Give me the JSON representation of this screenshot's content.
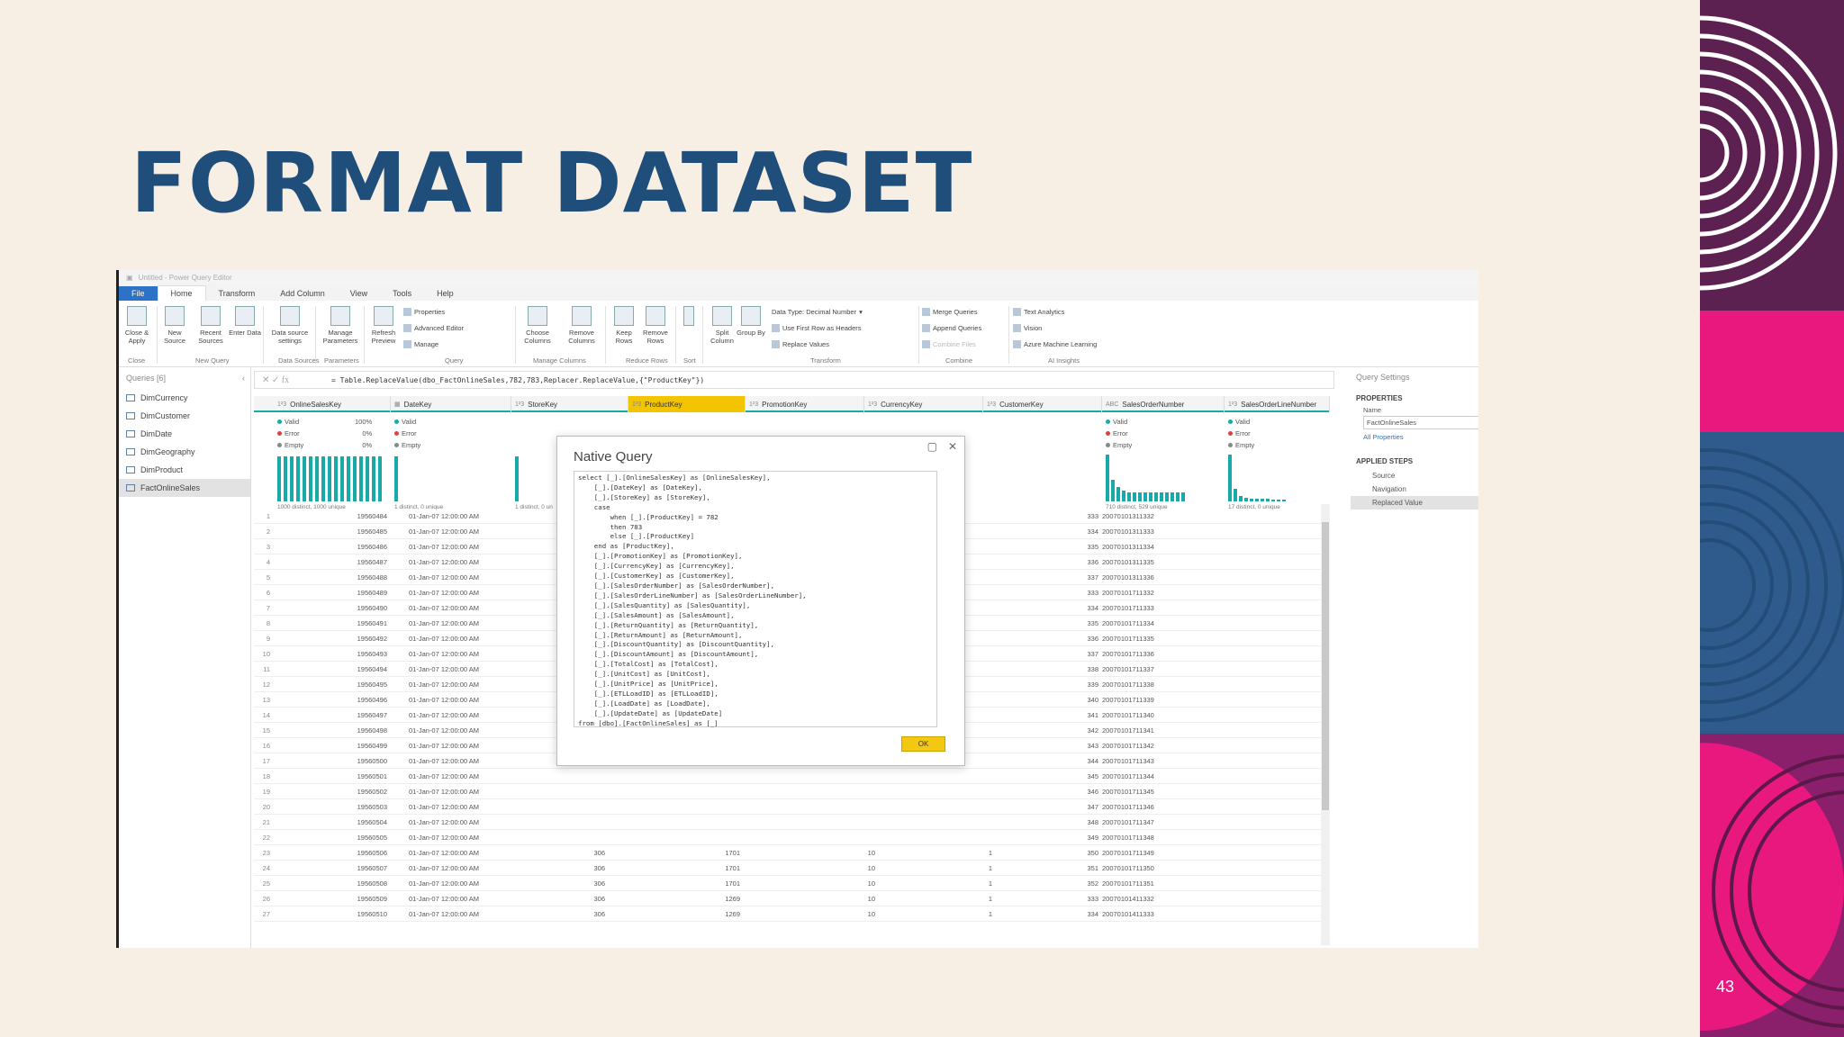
{
  "slide": {
    "title": "FORMAT DATASET",
    "number": "43"
  },
  "app": {
    "title": "Untitled - Power Query Editor",
    "menu": [
      "File",
      "Home",
      "Transform",
      "Add Column",
      "View",
      "Tools",
      "Help"
    ]
  },
  "ribbon": {
    "buttons": [
      "Close & Apply",
      "New Source",
      "Recent Sources",
      "Enter Data",
      "Data source settings",
      "Manage Parameters",
      "Refresh Preview",
      "Choose Columns",
      "Remove Columns",
      "Keep Rows",
      "Remove Rows",
      "Split Column",
      "Group By"
    ],
    "small": [
      "Properties",
      "Advanced Editor",
      "Manage",
      "Data Type: Decimal Number",
      "Use First Row as Headers",
      "Replace Values",
      "Merge Queries",
      "Append Queries",
      "Combine Files",
      "Text Analytics",
      "Vision",
      "Azure Machine Learning"
    ],
    "groups": [
      "Close",
      "New Query",
      "Data Sources",
      "Parameters",
      "Query",
      "Manage Columns",
      "Reduce Rows",
      "Sort",
      "Transform",
      "Combine",
      "AI Insights"
    ]
  },
  "queries": {
    "header": "Queries [6]",
    "items": [
      "DimCurrency",
      "DimCustomer",
      "DimDate",
      "DimGeography",
      "DimProduct",
      "FactOnlineSales"
    ]
  },
  "formula": "= Table.ReplaceValue(dbo_FactOnlineSales,782,783,Replacer.ReplaceValue,{\"ProductKey\"})",
  "columns": [
    "OnlineSalesKey",
    "DateKey",
    "StoreKey",
    "ProductKey",
    "PromotionKey",
    "CurrencyKey",
    "CustomerKey",
    "SalesOrderNumber",
    "SalesOrderLineNumber"
  ],
  "profile": {
    "valid": "Valid",
    "error": "Error",
    "empty": "Empty",
    "p100": "100%",
    "p0": "0%",
    "distinct1": "1000 distinct, 1000 unique",
    "distinct2": "1 distinct, 0 unique",
    "distinct3": "1 distinct, 0 un",
    "distinct4": "710 distinct, 529 unique",
    "distinct5": "17 distinct, 0 unique"
  },
  "rows": [
    [
      "1",
      "19560484",
      "01-Jan-07 12:00:00 AM",
      "",
      "",
      "",
      "",
      "333",
      "20070101311332"
    ],
    [
      "2",
      "19560485",
      "01-Jan-07 12:00:00 AM",
      "",
      "",
      "",
      "",
      "334",
      "20070101311333"
    ],
    [
      "3",
      "19560486",
      "01-Jan-07 12:00:00 AM",
      "",
      "",
      "",
      "",
      "335",
      "20070101311334"
    ],
    [
      "4",
      "19560487",
      "01-Jan-07 12:00:00 AM",
      "",
      "",
      "",
      "",
      "336",
      "20070101311335"
    ],
    [
      "5",
      "19560488",
      "01-Jan-07 12:00:00 AM",
      "",
      "",
      "",
      "",
      "337",
      "20070101311336"
    ],
    [
      "6",
      "19560489",
      "01-Jan-07 12:00:00 AM",
      "",
      "",
      "",
      "",
      "333",
      "20070101711332"
    ],
    [
      "7",
      "19560490",
      "01-Jan-07 12:00:00 AM",
      "",
      "",
      "",
      "",
      "334",
      "20070101711333"
    ],
    [
      "8",
      "19560491",
      "01-Jan-07 12:00:00 AM",
      "",
      "",
      "",
      "",
      "335",
      "20070101711334"
    ],
    [
      "9",
      "19560492",
      "01-Jan-07 12:00:00 AM",
      "",
      "",
      "",
      "",
      "336",
      "20070101711335"
    ],
    [
      "10",
      "19560493",
      "01-Jan-07 12:00:00 AM",
      "",
      "",
      "",
      "",
      "337",
      "20070101711336"
    ],
    [
      "11",
      "19560494",
      "01-Jan-07 12:00:00 AM",
      "",
      "",
      "",
      "",
      "338",
      "20070101711337"
    ],
    [
      "12",
      "19560495",
      "01-Jan-07 12:00:00 AM",
      "",
      "",
      "",
      "",
      "339",
      "20070101711338"
    ],
    [
      "13",
      "19560496",
      "01-Jan-07 12:00:00 AM",
      "",
      "",
      "",
      "",
      "340",
      "20070101711339"
    ],
    [
      "14",
      "19560497",
      "01-Jan-07 12:00:00 AM",
      "",
      "",
      "",
      "",
      "341",
      "20070101711340"
    ],
    [
      "15",
      "19560498",
      "01-Jan-07 12:00:00 AM",
      "",
      "",
      "",
      "",
      "342",
      "20070101711341"
    ],
    [
      "16",
      "19560499",
      "01-Jan-07 12:00:00 AM",
      "",
      "",
      "",
      "",
      "343",
      "20070101711342"
    ],
    [
      "17",
      "19560500",
      "01-Jan-07 12:00:00 AM",
      "",
      "",
      "",
      "",
      "344",
      "20070101711343"
    ],
    [
      "18",
      "19560501",
      "01-Jan-07 12:00:00 AM",
      "",
      "",
      "",
      "",
      "345",
      "20070101711344"
    ],
    [
      "19",
      "19560502",
      "01-Jan-07 12:00:00 AM",
      "",
      "",
      "",
      "",
      "346",
      "20070101711345"
    ],
    [
      "20",
      "19560503",
      "01-Jan-07 12:00:00 AM",
      "",
      "",
      "",
      "",
      "347",
      "20070101711346"
    ],
    [
      "21",
      "19560504",
      "01-Jan-07 12:00:00 AM",
      "",
      "",
      "",
      "",
      "348",
      "20070101711347"
    ],
    [
      "22",
      "19560505",
      "01-Jan-07 12:00:00 AM",
      "",
      "",
      "",
      "",
      "349",
      "20070101711348"
    ],
    [
      "23",
      "19560506",
      "01-Jan-07 12:00:00 AM",
      "306",
      "1701",
      "10",
      "1",
      "350",
      "20070101711349"
    ],
    [
      "24",
      "19560507",
      "01-Jan-07 12:00:00 AM",
      "306",
      "1701",
      "10",
      "1",
      "351",
      "20070101711350"
    ],
    [
      "25",
      "19560508",
      "01-Jan-07 12:00:00 AM",
      "306",
      "1701",
      "10",
      "1",
      "352",
      "20070101711351"
    ],
    [
      "26",
      "19560509",
      "01-Jan-07 12:00:00 AM",
      "306",
      "1269",
      "10",
      "1",
      "333",
      "20070101411332"
    ],
    [
      "27",
      "19560510",
      "01-Jan-07 12:00:00 AM",
      "306",
      "1269",
      "10",
      "1",
      "334",
      "20070101411333"
    ]
  ],
  "settings": {
    "title": "Query Settings",
    "properties": "PROPERTIES",
    "name_label": "Name",
    "name_value": "FactOnlineSales",
    "all_props": "All Properties",
    "applied": "APPLIED STEPS",
    "steps": [
      "Source",
      "Navigation",
      "Replaced Value"
    ]
  },
  "dialog": {
    "title": "Native Query",
    "ok": "OK",
    "code": "select [_].[OnlineSalesKey] as [OnlineSalesKey],\n    [_].[DateKey] as [DateKey],\n    [_].[StoreKey] as [StoreKey],\n    case\n        when [_].[ProductKey] = 782\n        then 783\n        else [_].[ProductKey]\n    end as [ProductKey],\n    [_].[PromotionKey] as [PromotionKey],\n    [_].[CurrencyKey] as [CurrencyKey],\n    [_].[CustomerKey] as [CustomerKey],\n    [_].[SalesOrderNumber] as [SalesOrderNumber],\n    [_].[SalesOrderLineNumber] as [SalesOrderLineNumber],\n    [_].[SalesQuantity] as [SalesQuantity],\n    [_].[SalesAmount] as [SalesAmount],\n    [_].[ReturnQuantity] as [ReturnQuantity],\n    [_].[ReturnAmount] as [ReturnAmount],\n    [_].[DiscountQuantity] as [DiscountQuantity],\n    [_].[DiscountAmount] as [DiscountAmount],\n    [_].[TotalCost] as [TotalCost],\n    [_].[UnitCost] as [UnitCost],\n    [_].[UnitPrice] as [UnitPrice],\n    [_].[ETLLoadID] as [ETLLoadID],\n    [_].[LoadDate] as [LoadDate],\n    [_].[UpdateDate] as [UpdateDate]\nfrom [dbo].[FactOnlineSales] as [_]"
  },
  "colors": {
    "title": "#1f4e7a",
    "accent": "#f3c400",
    "teal": "#1aa9a9"
  }
}
